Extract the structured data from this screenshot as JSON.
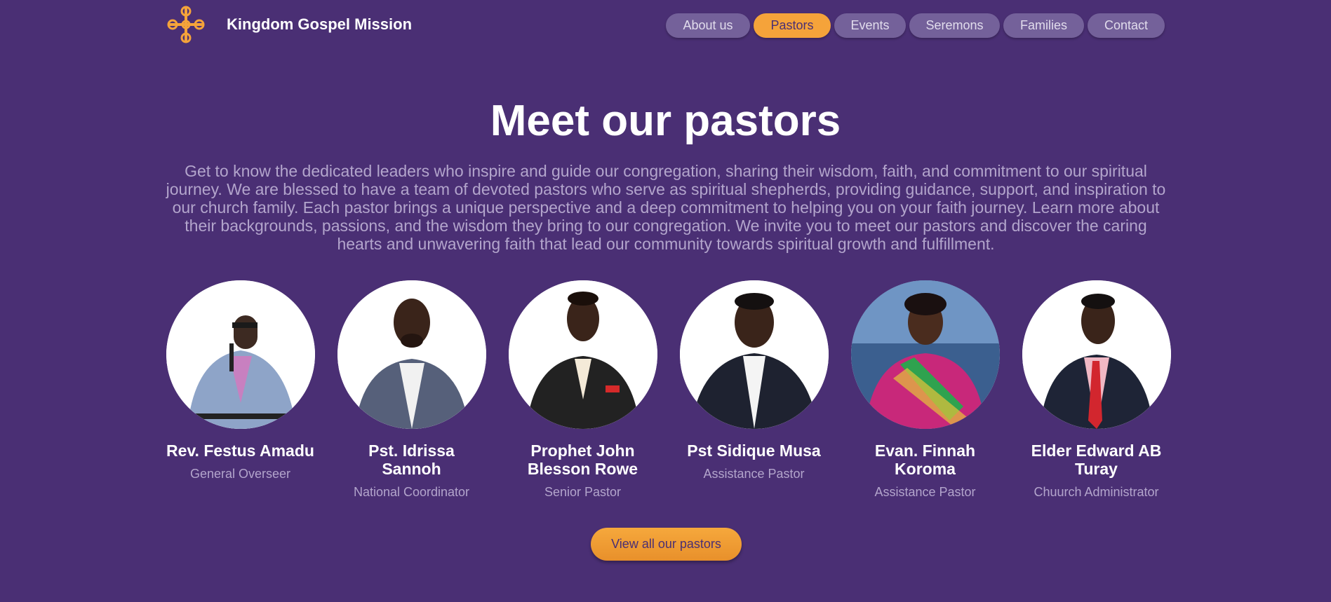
{
  "site": {
    "brand": "Kingdom Gospel Mission"
  },
  "nav": {
    "items": [
      {
        "label": "About us",
        "active": false
      },
      {
        "label": "Pastors",
        "active": true
      },
      {
        "label": "Events",
        "active": false
      },
      {
        "label": "Seremons",
        "active": false
      },
      {
        "label": "Families",
        "active": false
      },
      {
        "label": "Contact",
        "active": false
      }
    ]
  },
  "main": {
    "title": "Meet our pastors",
    "intro": "Get to know the dedicated leaders who inspire and guide our congregation, sharing their wisdom, faith, and commitment to our spiritual journey. We are blessed to have a team of devoted pastors who serve as spiritual shepherds, providing guidance, support, and inspiration to our church family. Each pastor brings a unique perspective and a deep commitment to helping you on your faith journey. Learn more about their backgrounds, passions, and the wisdom they bring to our congregation. We invite you to meet our pastors and discover the caring hearts and unwavering faith that lead our community towards spiritual growth and fulfillment.",
    "pastors": [
      {
        "name": "Rev. Festus Amadu",
        "role": "General Overseer"
      },
      {
        "name": "Pst. Idrissa Sannoh",
        "role": "National Coordinator"
      },
      {
        "name": "Prophet John Blesson Rowe",
        "role": "Senior Pastor"
      },
      {
        "name": "Pst Sidique Musa",
        "role": "Assistance Pastor"
      },
      {
        "name": "Evan. Finnah Koroma",
        "role": "Assistance Pastor"
      },
      {
        "name": "Elder Edward AB Turay",
        "role": "Chuurch Administrator"
      }
    ],
    "cta_label": "View all our pastors"
  },
  "colors": {
    "background": "#4a2f74",
    "accent": "#f5a33a",
    "nav_button": "#74619a",
    "muted_text": "#b3a5cc"
  }
}
